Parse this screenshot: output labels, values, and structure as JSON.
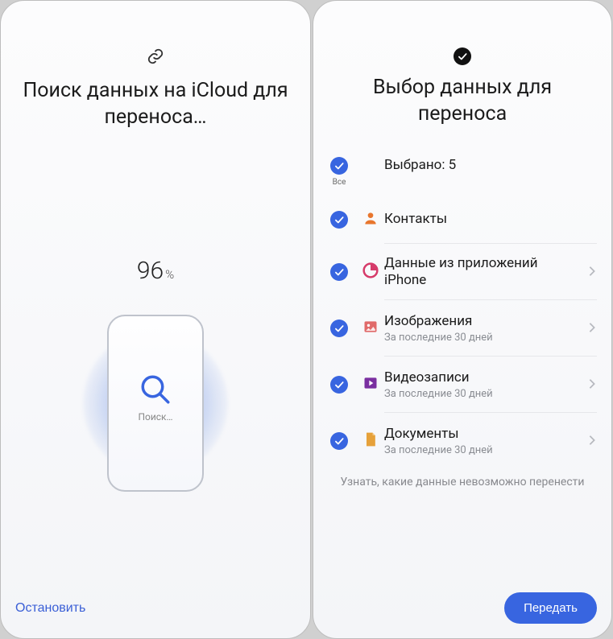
{
  "left": {
    "title": "Поиск данных на iCloud для переноса…",
    "progress_value": "96",
    "progress_pct_sign": "%",
    "phone_search_label": "Поиск…",
    "stop_label": "Остановить"
  },
  "right": {
    "title": "Выбор данных для переноса",
    "all_label": "Все",
    "selected_summary": "Выбрано: 5",
    "items": [
      {
        "title": "Контакты",
        "sub": "",
        "icon": "contact",
        "chevron": false
      },
      {
        "title": "Данные из приложений iPhone",
        "sub": "",
        "icon": "appdata",
        "chevron": true
      },
      {
        "title": "Изображения",
        "sub": "За последние 30 дней",
        "icon": "images",
        "chevron": true
      },
      {
        "title": "Видеозаписи",
        "sub": "За последние 30 дней",
        "icon": "videos",
        "chevron": true
      },
      {
        "title": "Документы",
        "sub": "За последние 30 дней",
        "icon": "docs",
        "chevron": true
      }
    ],
    "cannot_transfer_info": "Узнать, какие данные невозможно перенести",
    "transfer_label": "Передать"
  }
}
